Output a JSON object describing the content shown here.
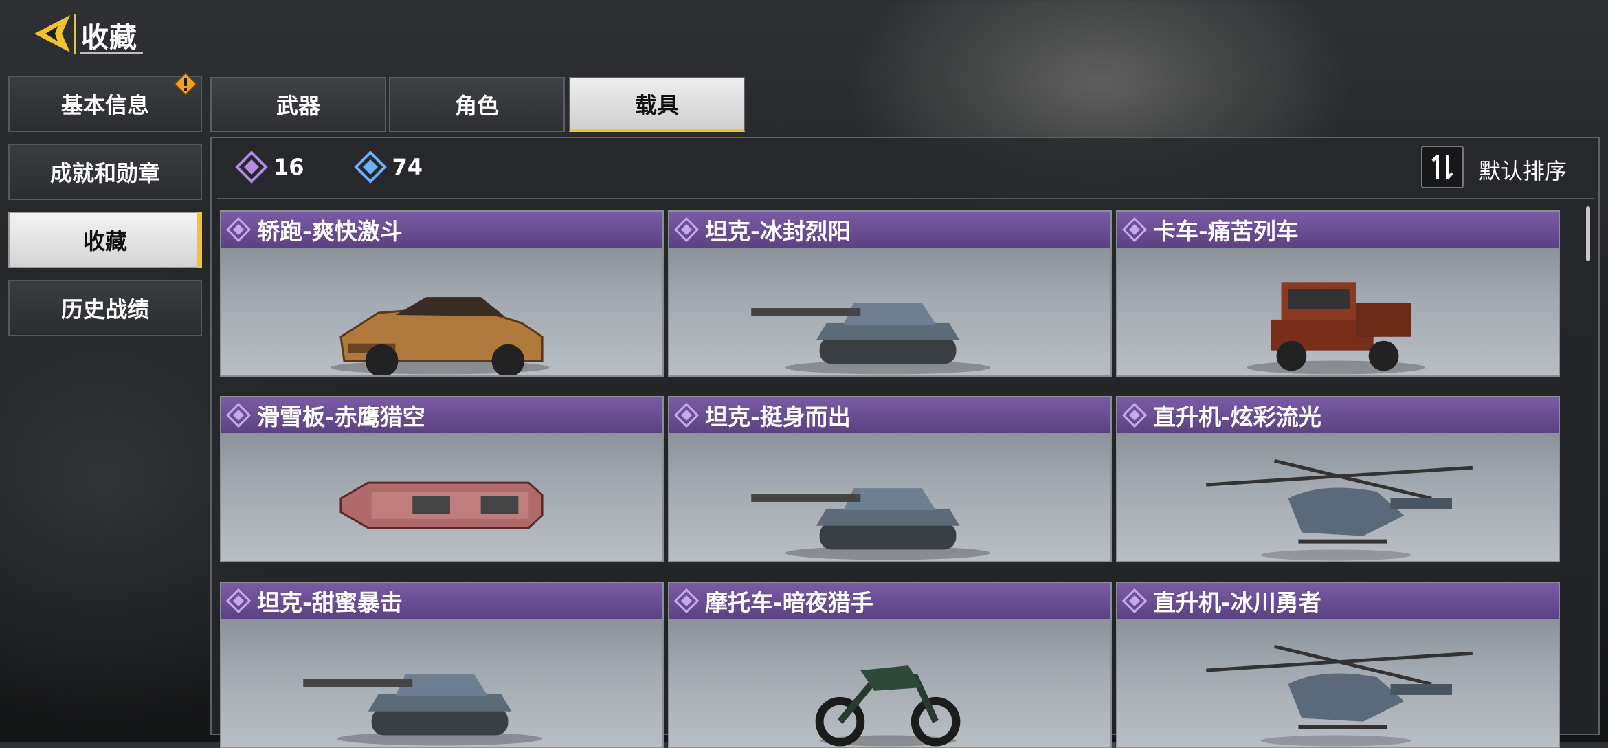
{
  "header": {
    "title": "收藏",
    "back_icon": "back-arrow-icon"
  },
  "sidebar": {
    "items": [
      {
        "label": "基本信息",
        "has_alert": true
      },
      {
        "label": "成就和勋章"
      },
      {
        "label": "收藏",
        "active": true
      },
      {
        "label": "历史战绩"
      }
    ]
  },
  "tabs": [
    {
      "label": "武器"
    },
    {
      "label": "角色"
    },
    {
      "label": "载具",
      "active": true
    }
  ],
  "counts": [
    {
      "icon": "purple-diamond-icon",
      "value": "16",
      "color": "#b48ce6"
    },
    {
      "icon": "blue-diamond-icon",
      "value": "74",
      "color": "#6fb0ff"
    }
  ],
  "sort": {
    "label": "默认排序",
    "icon": "sort-icon"
  },
  "items": [
    {
      "name": "轿跑-爽快激斗",
      "type": "car"
    },
    {
      "name": "坦克-冰封烈阳",
      "type": "tank"
    },
    {
      "name": "卡车-痛苦列车",
      "type": "truck"
    },
    {
      "name": "滑雪板-赤鹰猎空",
      "type": "snowboard"
    },
    {
      "name": "坦克-挺身而出",
      "type": "tank"
    },
    {
      "name": "直升机-炫彩流光",
      "type": "helicopter"
    },
    {
      "name": "坦克-甜蜜暴击",
      "type": "tank"
    },
    {
      "name": "摩托车-暗夜猎手",
      "type": "motorcycle"
    },
    {
      "name": "直升机-冰川勇者",
      "type": "helicopter"
    }
  ],
  "colors": {
    "accent": "#f2c230",
    "card_header": "#6a4e94"
  }
}
